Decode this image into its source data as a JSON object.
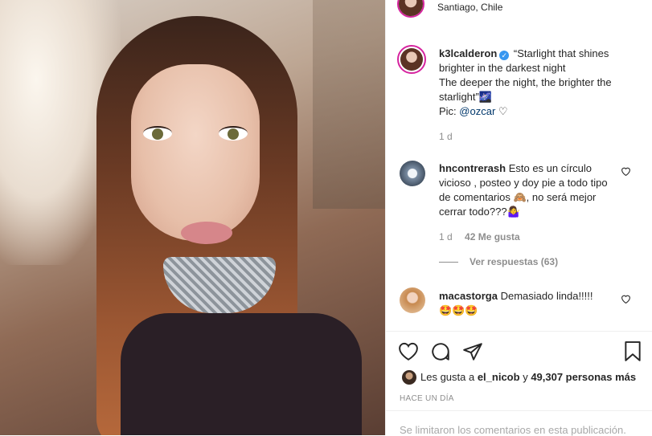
{
  "post": {
    "location": "Santiago, Chile"
  },
  "caption": {
    "username": "k3lcalderon",
    "line1": "“Starlight that shines brighter in the darkest night",
    "line2": "The deeper the night, the brighter the starlight”🌌",
    "pic_prefix": "Pic: ",
    "pic_mention": "@ozcar",
    "heart": "♡",
    "time": "1 d"
  },
  "comments": [
    {
      "username": "hncontrerash",
      "text": "Esto es un círculo vicioso , posteo y doy pie a todo tipo de comentarios 🙈, no será mejor cerrar todo???🤷‍♀️",
      "time": "1 d",
      "likes": "42 Me gusta",
      "replies": "Ver respuestas (63)"
    },
    {
      "username": "macastorga",
      "text": "Demasiado linda!!!!!",
      "emojis": "🤩🤩🤩"
    }
  ],
  "likes": {
    "prefix": "Les gusta a ",
    "user": "el_nicob",
    "middle": " y ",
    "count": "49,307 personas más"
  },
  "time_ago": "HACE UN DÍA",
  "comments_limited": "Se limitaron los comentarios en esta publicación.",
  "icons": [
    "heart-icon",
    "comment-icon",
    "share-icon",
    "bookmark-icon",
    "verified-icon"
  ],
  "colors": {
    "verified": "#3897f0",
    "mention": "#00376b",
    "muted": "#8e8e8e",
    "story_ring": "#d6249f"
  }
}
